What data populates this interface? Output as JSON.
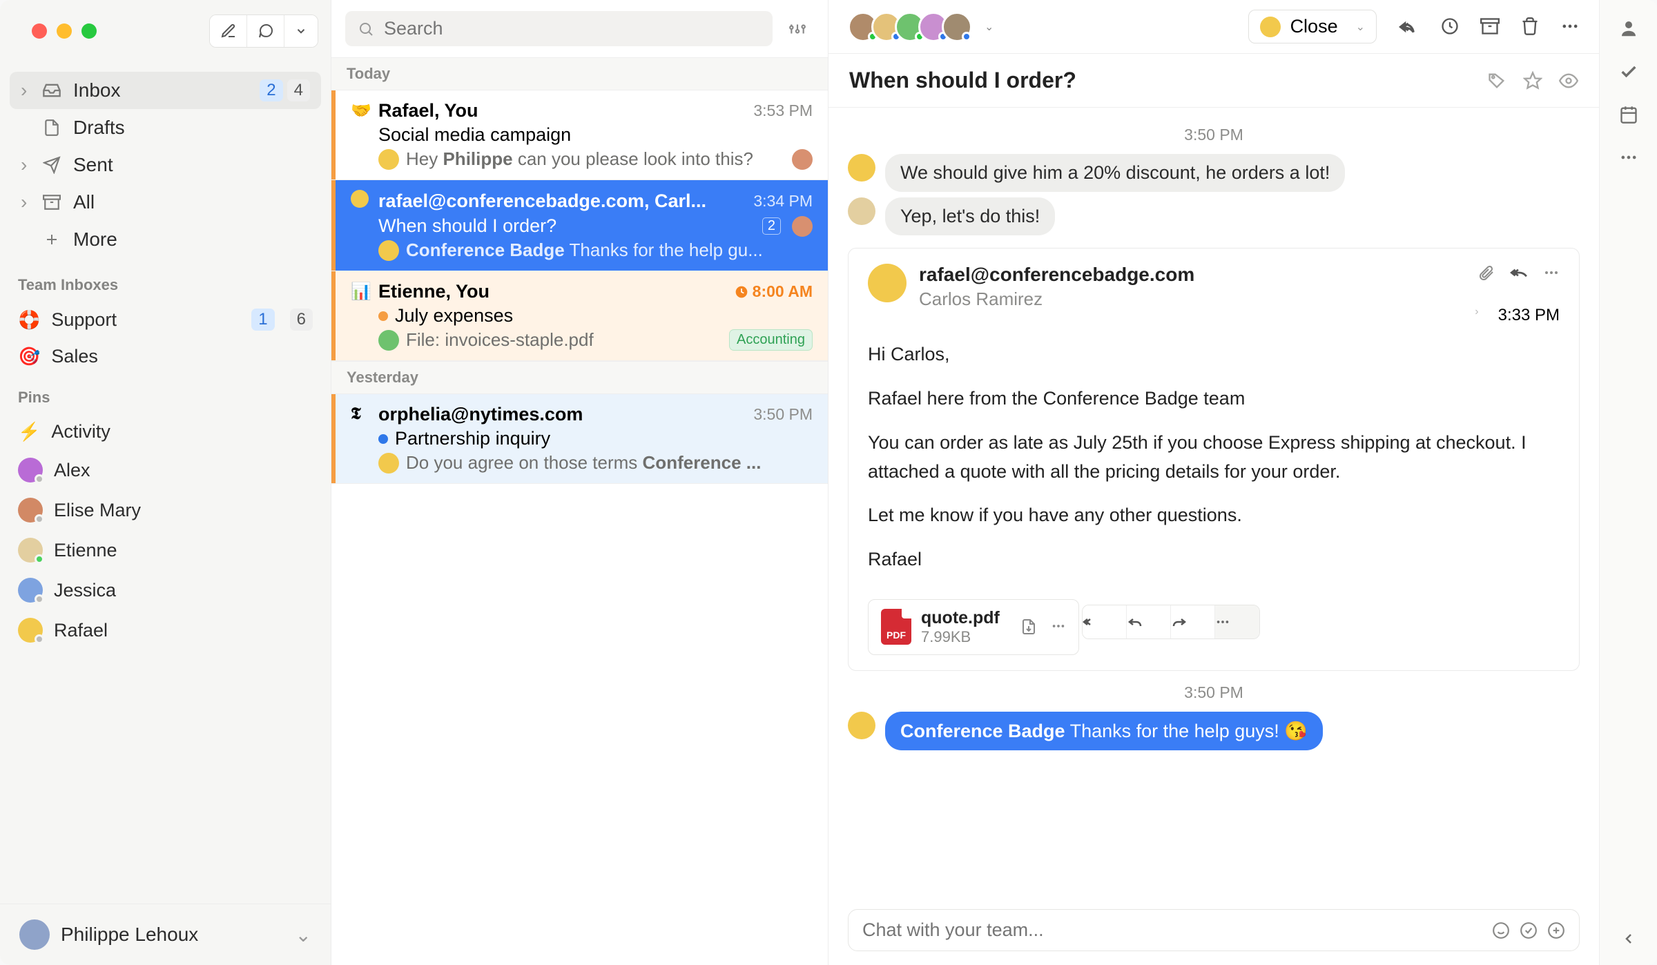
{
  "sidebar": {
    "nav": [
      {
        "label": "Inbox",
        "badge_blue": "2",
        "badge": "4",
        "sel": true,
        "icon": "inbox",
        "chev": true
      },
      {
        "label": "Drafts",
        "icon": "file"
      },
      {
        "label": "Sent",
        "icon": "send",
        "chev": true
      },
      {
        "label": "All",
        "icon": "archive",
        "chev": true
      },
      {
        "label": "More",
        "icon": "plus"
      }
    ],
    "sect1": "Team Inboxes",
    "team": [
      {
        "label": "Support",
        "badge_blue": "1",
        "badge": "6",
        "emoji": "🛟"
      },
      {
        "label": "Sales",
        "emoji": "🎯"
      }
    ],
    "sect2": "Pins",
    "pins": [
      {
        "label": "Activity",
        "emoji": "⚡"
      },
      {
        "label": "Alex"
      },
      {
        "label": "Elise Mary"
      },
      {
        "label": "Etienne"
      },
      {
        "label": "Jessica"
      },
      {
        "label": "Rafael"
      }
    ],
    "user": "Philippe Lehoux"
  },
  "topbtns": {
    "compose": "✎",
    "thread": "💬",
    "menu": "▾"
  },
  "search": {
    "placeholder": "Search"
  },
  "list": {
    "sections": [
      {
        "header": "Today",
        "items": [
          {
            "from": "Rafael, You",
            "time": "3:53 PM",
            "subject": "Social media campaign",
            "preview_pre": "Hey ",
            "preview_bold": "Philippe",
            "preview_post": " can you please look into this?",
            "tag": "🤝",
            "end_av": true
          },
          {
            "from": "rafael@conferencebadge.com, Carl...",
            "time": "3:34 PM",
            "subject": "When should I order?",
            "preview_bold": "Conference Badge",
            "preview_post": " Thanks for the help gu...",
            "sel": true,
            "count": "2",
            "end_av": true,
            "tag": "📧"
          },
          {
            "from": "Etienne, You",
            "time": "8:00 AM",
            "time_warn": true,
            "subject": "July expenses",
            "preview_pre": "File: invoices-staple.pdf",
            "chip": "Accounting",
            "warn": true,
            "tag": "📊",
            "dot": "orange"
          }
        ]
      },
      {
        "header": "Yesterday",
        "items": [
          {
            "from": "orphelia@nytimes.com",
            "time": "3:50 PM",
            "subject": "Partnership inquiry",
            "preview_pre": "Do you agree on those terms ",
            "preview_bold": "Conference ...",
            "alt": true,
            "tag": "𝕿",
            "dot": "blue"
          }
        ]
      }
    ]
  },
  "thread": {
    "close": "Close",
    "subject": "When should I order?",
    "ts1": "3:50 PM",
    "chat1": "We should give him a 20% discount, he orders a lot!",
    "chat2": "Yep, let's do this!",
    "email": {
      "from": "rafael@conferencebadge.com",
      "to": "Carlos Ramirez",
      "time": "3:33 PM",
      "p1": "Hi Carlos,",
      "p2": "Rafael here from the Conference Badge team",
      "p3": "You can order as late as July 25th if you choose Express shipping at checkout. I attached a quote with all the pricing details for your order.",
      "p4": "Let me know if you have any other questions.",
      "p5": "Rafael",
      "att_name": "quote.pdf",
      "att_size": "7.99KB"
    },
    "ts2": "3:50 PM",
    "chat3_b": "Conference Badge",
    "chat3_t": " Thanks for the help guys! ",
    "chat3_e": "😘",
    "composer": "Chat with your team..."
  }
}
